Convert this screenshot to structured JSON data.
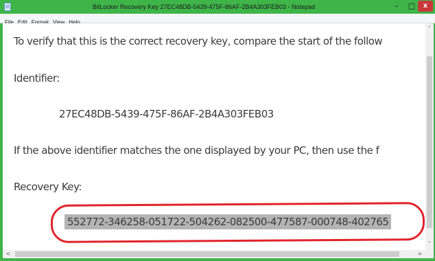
{
  "window": {
    "title": "BitLocker Recovery Key 27EC48DB-5439-475F-86AF-2B4A303FEB03 - Notepad",
    "controls": {
      "minimize": "–",
      "maximize": "□",
      "close": "x"
    },
    "accent_color": "#3fb549"
  },
  "menu": [
    "File",
    "Edit",
    "Format",
    "View",
    "Help"
  ],
  "document": {
    "line1": "To verify that this is the correct recovery key, compare the start of the follow",
    "line2": "Identifier:",
    "identifier": "27EC48DB-5439-475F-86AF-2B4A303FEB03",
    "line4": "If the above identifier matches the one displayed by your PC, then use the f",
    "line5": "Recovery Key:",
    "recovery_key": "552772-346258-051722-504262-082500-477587-000748-402765"
  },
  "annotation": {
    "ring_color": "#e0232b"
  },
  "scrollbars": {
    "up": "˄",
    "down": "˅",
    "left": "<",
    "right": ">"
  }
}
